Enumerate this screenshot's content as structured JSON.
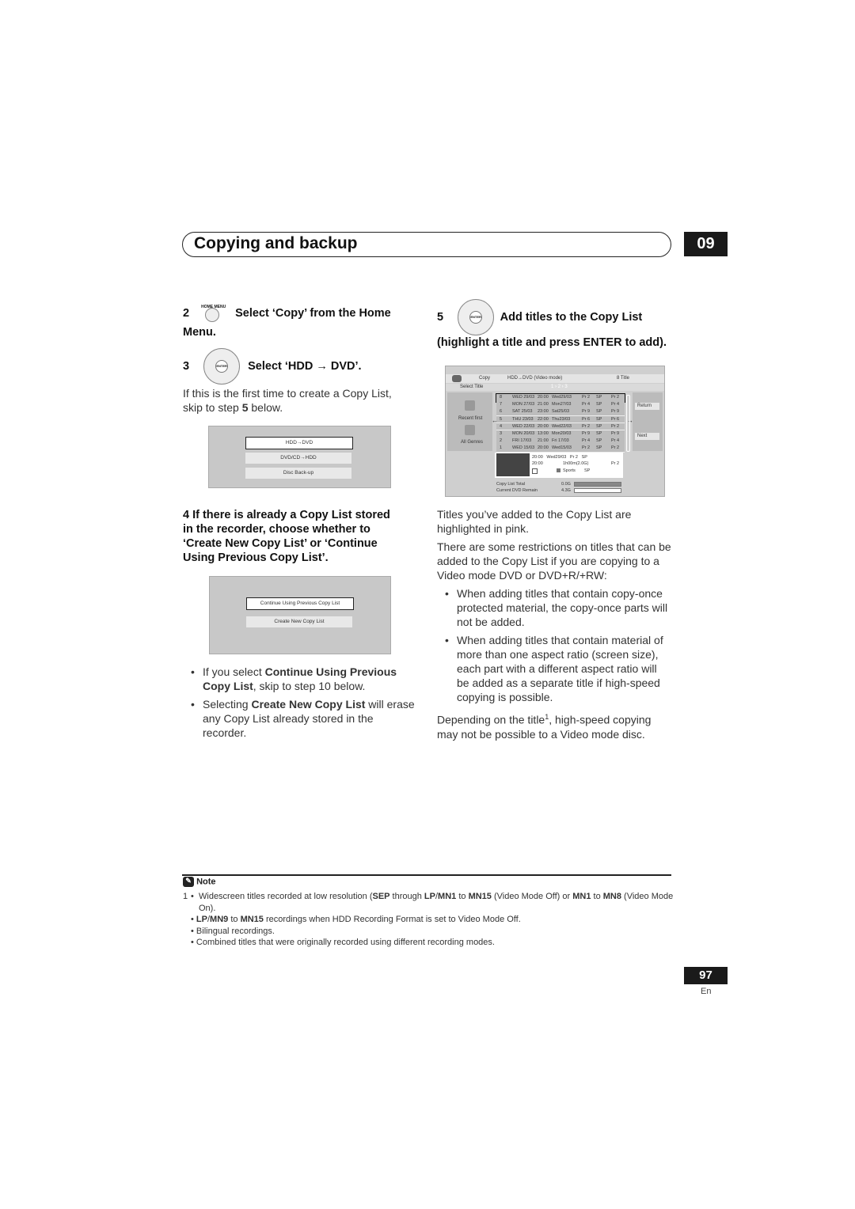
{
  "header": {
    "title": "Copying and backup",
    "chapter": "09"
  },
  "left": {
    "step2": {
      "num": "2",
      "icon_label": "HOME MENU",
      "text": "Select ‘Copy’ from the Home",
      "text2": "Menu."
    },
    "step3": {
      "num": "3",
      "text": "Select ‘HDD → DVD’.",
      "body": "If this is the first time to create a Copy List, skip to step ",
      "body_bold": "5",
      "body_end": " below."
    },
    "screen1": {
      "items": [
        "HDD→DVD",
        "DVD/CD→HDD",
        "Disc Back-up"
      ]
    },
    "step4": {
      "lines": [
        "4   If there is already a Copy List stored",
        "in the recorder, choose whether to",
        "‘Create New Copy List’ or ‘Continue",
        "Using Previous Copy List’."
      ]
    },
    "screen2": {
      "items": [
        "Continue Using Previous Copy List",
        "Create New Copy List"
      ]
    },
    "bullets": [
      {
        "a": "If you select ",
        "b": "Continue Using Previous Copy List",
        "c": ", skip to step 10 below."
      },
      {
        "a": "Selecting ",
        "b": "Create New Copy List",
        "c": " will erase any Copy List already stored in the recorder."
      }
    ]
  },
  "right": {
    "step5": {
      "num": "5",
      "text": "Add titles to the Copy List",
      "text2": "(highlight a title and press ENTER to add)."
    },
    "copy_screen": {
      "title": "Copy",
      "mode": "HDD→DVD (Video mode)",
      "count": "8 Title",
      "subtitle": "Select Title",
      "pages": "1 › 2 › 3",
      "left_labels": [
        "Recent first",
        "All Genres"
      ],
      "right_buttons": [
        "Return",
        "Next"
      ],
      "rows": [
        [
          "8",
          "WED 29/03",
          "20:00",
          "Wed29/03",
          "Pr 2",
          "SP",
          "Pr 2"
        ],
        [
          "7",
          "MON 27/03",
          "21:00",
          "Mon27/03",
          "Pr 4",
          "SP",
          "Pr 4"
        ],
        [
          "6",
          "SAT 25/03",
          "23:00",
          "Sat25/03",
          "Pr 9",
          "SP",
          "Pr 9"
        ],
        [
          "5",
          "THU 23/03",
          "22:00",
          "Thu23/03",
          "Pr 6",
          "SP",
          "Pr 6"
        ],
        [
          "4",
          "WED 22/03",
          "20:00",
          "Wed22/03",
          "Pr 2",
          "SP",
          "Pr 2"
        ],
        [
          "3",
          "MON 20/03",
          "13:00",
          "Mon20/03",
          "Pr 9",
          "SP",
          "Pr 9"
        ],
        [
          "2",
          "FRI 17/03",
          "21:00",
          "Fri 17/03",
          "Pr 4",
          "SP",
          "Pr 4"
        ],
        [
          "1",
          "WED 15/03",
          "20:00",
          "Wed15/03",
          "Pr 2",
          "SP",
          "Pr 2"
        ]
      ],
      "detail": {
        "l1": "20:00   Wed29/03   Pr 2   SP",
        "l2a": "20:00",
        "l2b": "1h00m(2.0G)",
        "l2c": "Pr 2",
        "genre": "Sports",
        "mode": "SP"
      },
      "totals": [
        {
          "label": "Copy List Total",
          "value": "0.0G",
          "fill": 1.0
        },
        {
          "label": "Current DVD Remain",
          "value": "4.3G",
          "fill": 0.0
        }
      ]
    },
    "para1": "Titles you’ve added to the Copy List are highlighted in pink.",
    "para2": "There are some restrictions on titles that can be added to the Copy List if you are copying to a Video mode DVD or DVD+R/+RW:",
    "bullets": [
      "When adding titles that contain copy-once protected material, the copy-once parts will not be added.",
      "When adding titles that contain material of more than one aspect ratio (screen size), each part with a different aspect ratio will be added as a separate title if high-speed copying is possible."
    ],
    "para3a": "Depending on the title",
    "para3sup": "1",
    "para3b": ", high-speed copying may not be possible to a Video mode disc."
  },
  "note": {
    "heading": "Note",
    "n1": {
      "num": "1",
      "a": "Widescreen titles recorded at low resolution (",
      "b1": "SEP",
      "c1": " through ",
      "b2": "LP",
      "c2": "/",
      "b3": "MN1",
      "c3": " to ",
      "b4": "MN15",
      "c4": " (Video Mode Off) or ",
      "b5": "MN1",
      "c5": " to ",
      "b6": "MN8",
      "c6": " (Video Mode On)."
    },
    "n2": {
      "b1": "LP",
      "c1": "/",
      "b2": "MN9",
      "c2": " to ",
      "b3": "MN15",
      "c3": " recordings when HDD Recording Format is set to Video Mode Off."
    },
    "n3": "Bilingual recordings.",
    "n4": "Combined titles that were originally recorded using different recording modes."
  },
  "footer": {
    "page": "97",
    "lang": "En"
  }
}
